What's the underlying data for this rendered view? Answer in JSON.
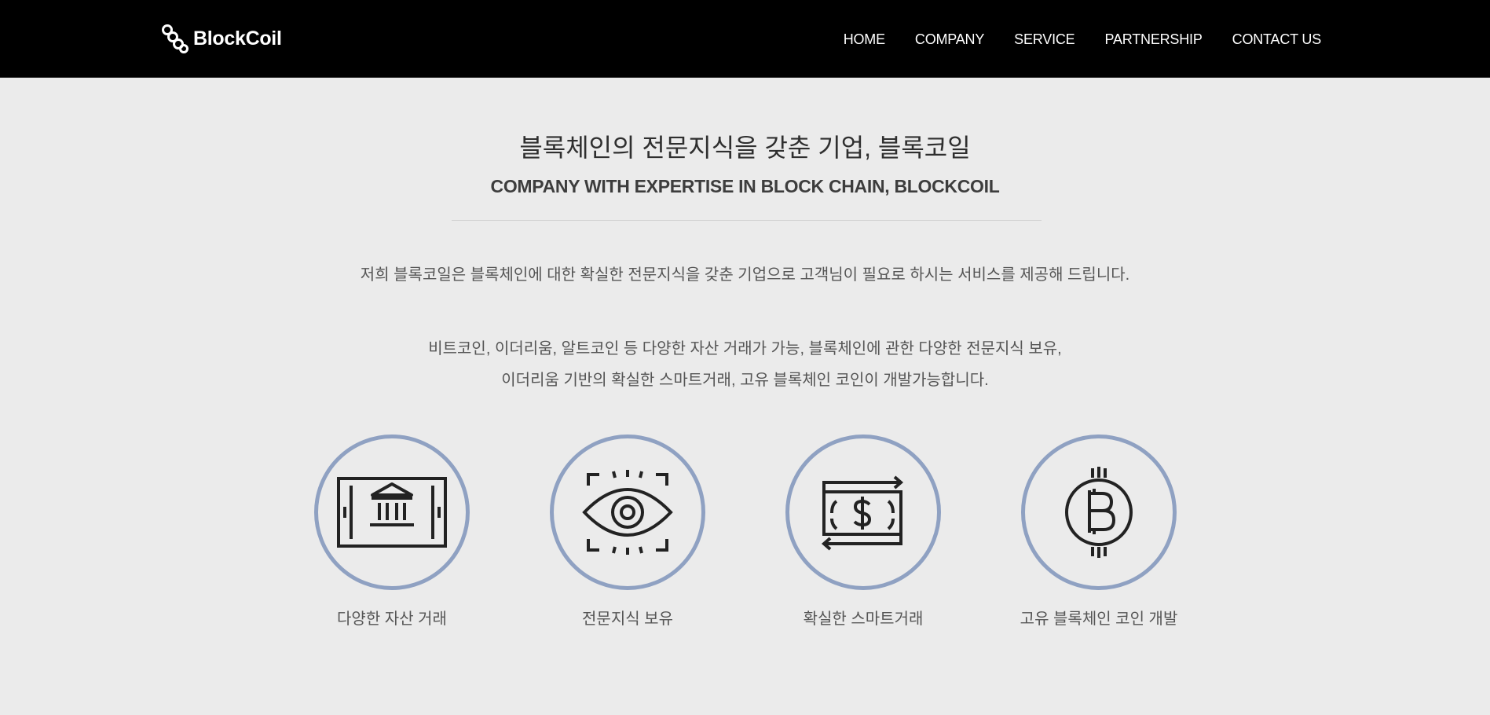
{
  "header": {
    "logo_text": "BlockCoil",
    "nav": [
      {
        "label": "HOME"
      },
      {
        "label": "COMPANY"
      },
      {
        "label": "SERVICE"
      },
      {
        "label": "PARTNERSHIP"
      },
      {
        "label": "CONTACT US"
      }
    ]
  },
  "main": {
    "title_kr": "블록체인의 전문지식을 갖춘 기업, 블록코일",
    "title_en": "COMPANY WITH EXPERTISE IN BLOCK CHAIN, BLOCKCOIL",
    "intro": "저희 블록코일은 블록체인에 대한 확실한 전문지식을 갖춘 기업으로 고객님이 필요로 하시는 서비스를 제공해 드립니다.",
    "desc_line1": "비트코인, 이더리움, 알트코인 등 다양한 자산 거래가 가능, 블록체인에 관한 다양한 전문지식 보유,",
    "desc_line2": "이더리움 기반의 확실한 스마트거래, 고유 블록체인 코인이 개발가능합니다."
  },
  "features": [
    {
      "label": "다양한 자산 거래",
      "icon": "bank-card-icon"
    },
    {
      "label": "전문지식 보유",
      "icon": "eye-scan-icon"
    },
    {
      "label": "확실한 스마트거래",
      "icon": "money-exchange-icon"
    },
    {
      "label": "고유 블록체인 코인 개발",
      "icon": "bitcoin-icon"
    }
  ],
  "colors": {
    "header_bg": "#000000",
    "page_bg": "#ebebeb",
    "circle_border": "#8fa1c2"
  }
}
